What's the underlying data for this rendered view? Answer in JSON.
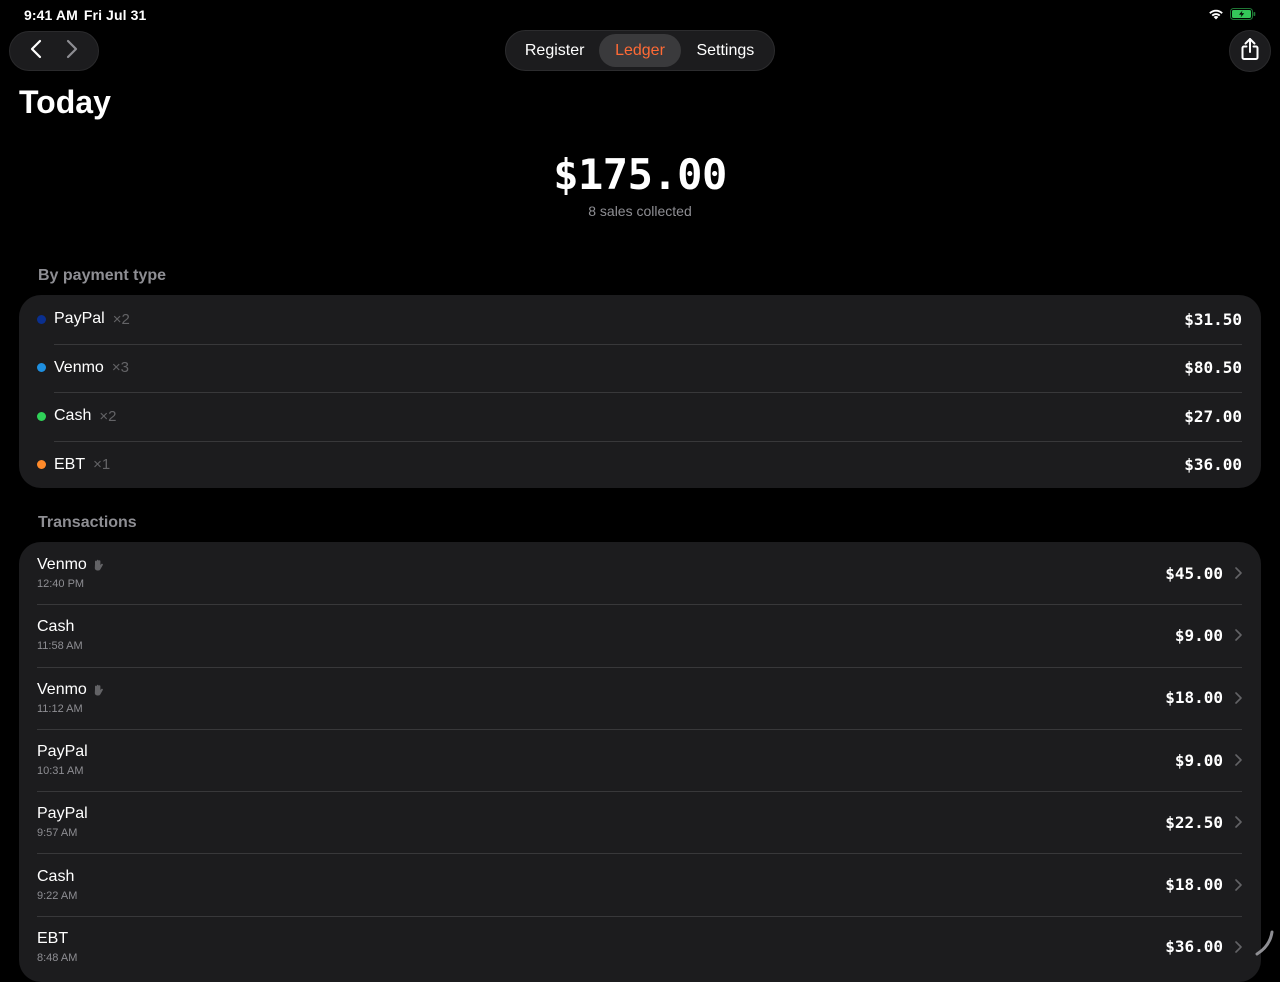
{
  "status_bar": {
    "time": "9:41 AM",
    "date": "Fri Jul 31"
  },
  "nav": {
    "back_icon": "chevron-left-icon",
    "forward_icon": "chevron-right-icon"
  },
  "tabs": [
    {
      "label": "Register",
      "selected": false
    },
    {
      "label": "Ledger",
      "selected": true
    },
    {
      "label": "Settings",
      "selected": false
    }
  ],
  "share_icon": "share-icon",
  "page": {
    "title": "Today",
    "total": "$175.00",
    "subtitle": "8 sales collected"
  },
  "payment_section": {
    "label": "By payment type",
    "items": [
      {
        "name": "PayPal",
        "count": "×2",
        "amount": "$31.50",
        "color": "#0a2f8f"
      },
      {
        "name": "Venmo",
        "count": "×3",
        "amount": "$80.50",
        "color": "#1e8fe0"
      },
      {
        "name": "Cash",
        "count": "×2",
        "amount": "$27.00",
        "color": "#2fd158"
      },
      {
        "name": "EBT",
        "count": "×1",
        "amount": "$36.00",
        "color": "#ff8a2a"
      }
    ]
  },
  "transactions_section": {
    "label": "Transactions",
    "items": [
      {
        "method": "Venmo",
        "time": "12:40 PM",
        "amount": "$45.00",
        "tagged": true
      },
      {
        "method": "Cash",
        "time": "11:58 AM",
        "amount": "$9.00",
        "tagged": false
      },
      {
        "method": "Venmo",
        "time": "11:12 AM",
        "amount": "$18.00",
        "tagged": true
      },
      {
        "method": "PayPal",
        "time": "10:31 AM",
        "amount": "$9.00",
        "tagged": false
      },
      {
        "method": "PayPal",
        "time": "9:57 AM",
        "amount": "$22.50",
        "tagged": false
      },
      {
        "method": "Cash",
        "time": "9:22 AM",
        "amount": "$18.00",
        "tagged": false
      },
      {
        "method": "EBT",
        "time": "8:48 AM",
        "amount": "$36.00",
        "tagged": false
      }
    ]
  },
  "colors": {
    "accent": "#ff6a35",
    "background": "#000000",
    "card": "#1c1c1e",
    "battery": "#34c759"
  }
}
